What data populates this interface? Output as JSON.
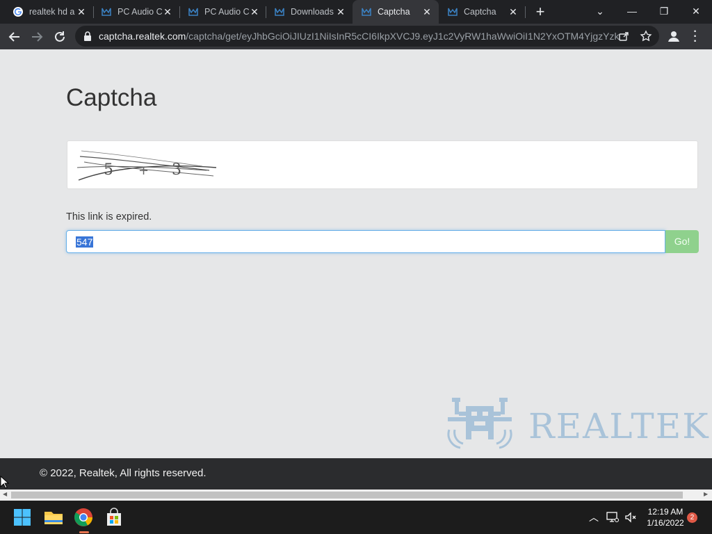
{
  "browser": {
    "tabs": [
      {
        "label": "realtek hd a",
        "icon": "google-icon"
      },
      {
        "label": "PC Audio C",
        "icon": "realtek-icon"
      },
      {
        "label": "PC Audio C",
        "icon": "realtek-icon"
      },
      {
        "label": "Downloads",
        "icon": "realtek-icon"
      },
      {
        "label": "Captcha",
        "icon": "realtek-icon",
        "active": true
      },
      {
        "label": "Captcha",
        "icon": "realtek-icon"
      }
    ],
    "url_host": "captcha.realtek.com",
    "url_path": "/captcha/get/eyJhbGciOiJIUzI1NiIsInR5cCI6IkpXVCJ9.eyJ1c2VyRW1haWwiOiI1N2YxOTM4YjgzYzk1..."
  },
  "page": {
    "title": "Captcha",
    "message": "This link is expired.",
    "answer_value": "547",
    "go_label": "Go!",
    "logo_text": "REALTEK",
    "copyright": "© 2022, Realtek, All rights reserved."
  },
  "taskbar": {
    "time": "12:19 AM",
    "date": "1/16/2022",
    "notification_count": "2"
  },
  "colors": {
    "page_bg": "#e6e7e8",
    "go_button": "#8fd18d",
    "logo": "#a9c3d9",
    "footer": "#2b2c2e"
  }
}
